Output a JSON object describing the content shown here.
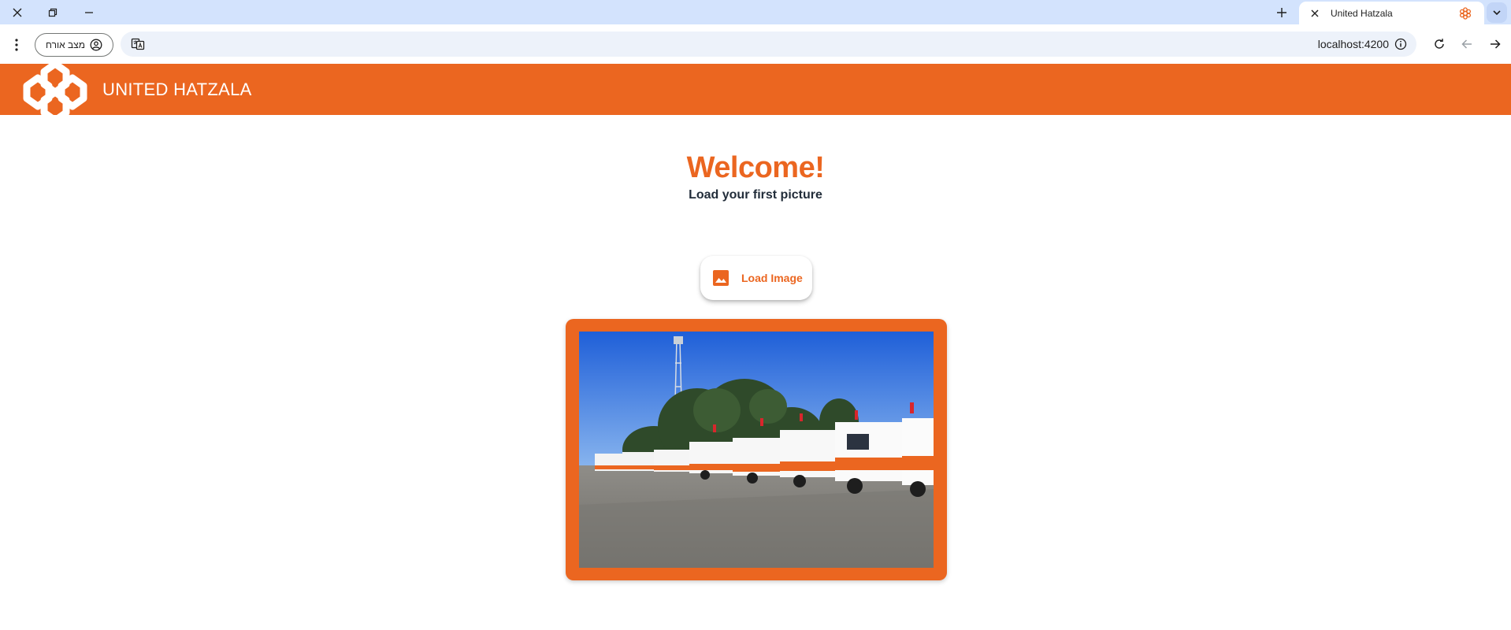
{
  "browser": {
    "tab": {
      "title": "United Hatzala"
    },
    "address_bar": {
      "url": "localhost:4200"
    },
    "profile": {
      "label": "מצב אורח"
    }
  },
  "app": {
    "brand": "UNITED HATZALA",
    "accent_color": "#eb6620",
    "heading": "Welcome!",
    "subheading": "Load your first picture",
    "load_button_label": "Load Image",
    "image": {
      "description_icon": "photo-of-ambulance-fleet"
    }
  }
}
